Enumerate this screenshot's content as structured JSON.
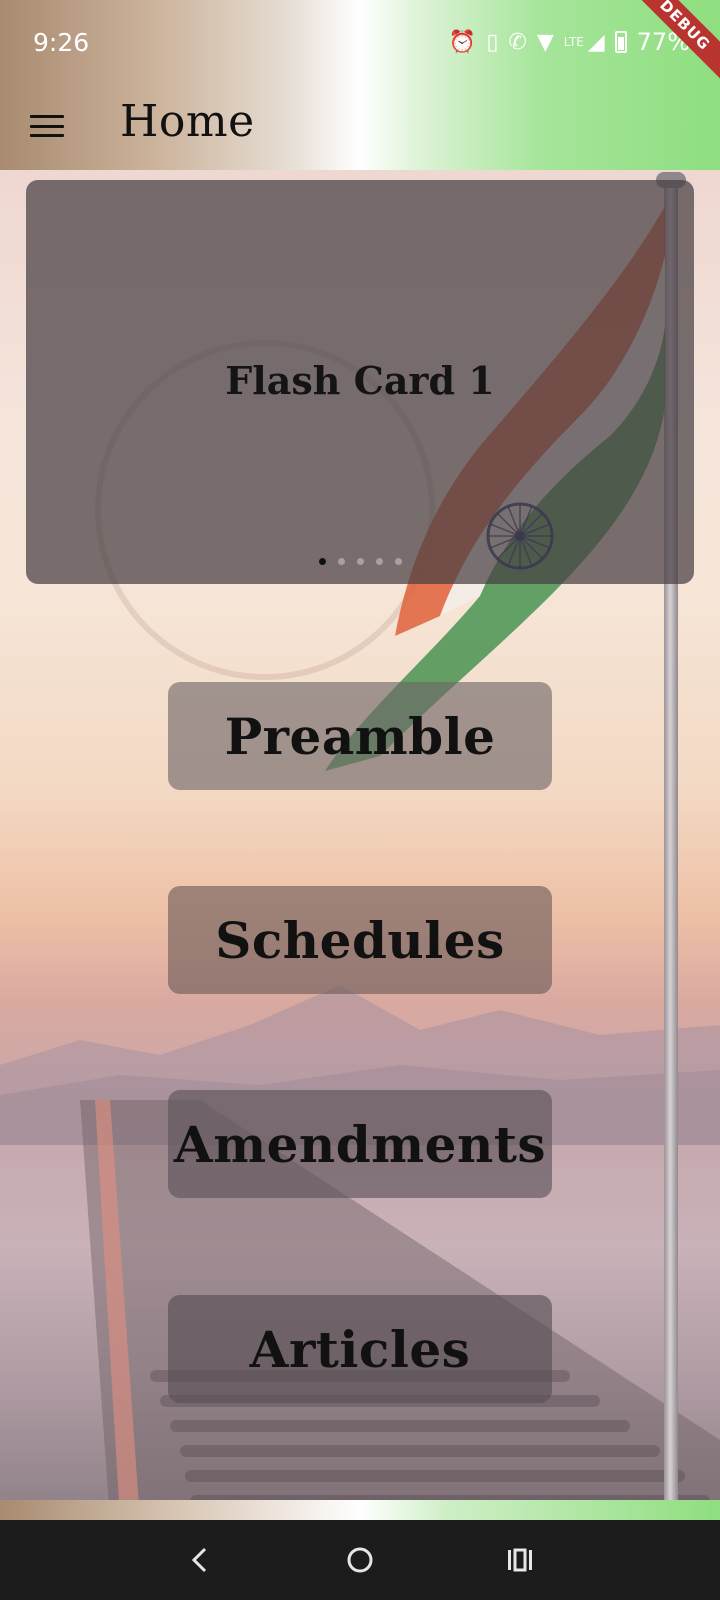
{
  "status_bar": {
    "time": "9:26",
    "network_label": "LTE",
    "battery": "77%"
  },
  "app_bar": {
    "title": "Home",
    "debug_banner": "DEBUG"
  },
  "carousel": {
    "card_label": "Flash Card 1",
    "total_cards": 5,
    "active_index": 0
  },
  "nav_buttons": {
    "preamble": "Preamble",
    "schedules": "Schedules",
    "amendments": "Amendments",
    "articles": "Articles"
  },
  "icons": {
    "menu": "hamburger-menu-icon",
    "back": "back-icon",
    "home": "home-icon",
    "recents": "recents-icon"
  },
  "colors": {
    "header_left": "#a88b70",
    "header_mid": "#ffffff",
    "header_right": "#8fde80",
    "flag_saffron": "#e0623c",
    "flag_green": "#3f8f4a",
    "chakra": "#1a2a6c"
  }
}
